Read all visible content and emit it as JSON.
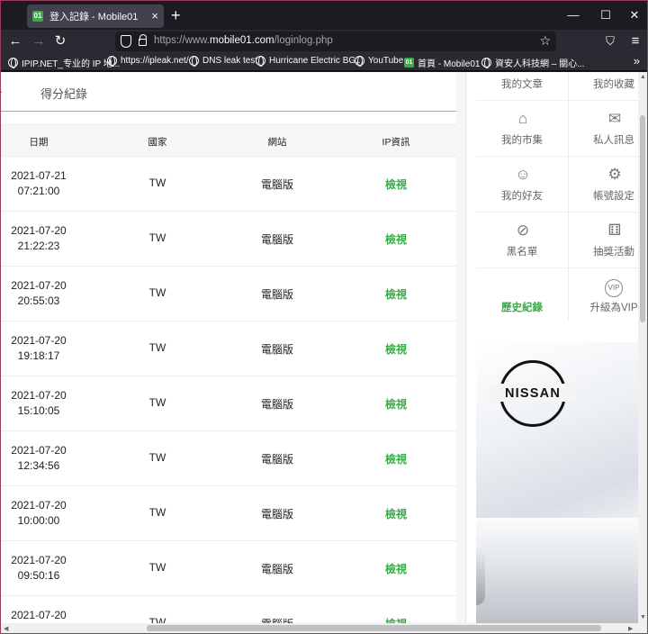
{
  "tab": {
    "title": "登入記錄 - Mobile01",
    "favicon": "01",
    "close": "×",
    "new_tab": "+"
  },
  "window": {
    "minimize": "—",
    "maximize": "☐",
    "close": "✕"
  },
  "nav": {
    "back": "←",
    "forward": "→",
    "reload": "↻",
    "url_prefix": "https://www.",
    "url_domain": "mobile01.com",
    "url_path": "/loginlog.php",
    "star": "☆",
    "pocket": "⛉",
    "menu": "≡"
  },
  "bookmarks": [
    {
      "label": "IPIP.NET_专业的 IP 地...",
      "icon": "globe-icon"
    },
    {
      "label": "https://ipleak.net/",
      "icon": "globe-icon"
    },
    {
      "label": "DNS leak test",
      "icon": "globe-icon"
    },
    {
      "label": "Hurricane Electric BG...",
      "icon": "globe-icon"
    },
    {
      "label": "YouTube",
      "icon": "globe-icon"
    },
    {
      "label": "首頁 - Mobile01",
      "icon": "mobile01-icon"
    },
    {
      "label": "資安人科技網 – 關心...",
      "icon": "globe-icon"
    }
  ],
  "bookmarks_more": "»",
  "main": {
    "tab_dot": "·",
    "tab_label": "得分紀錄",
    "columns": [
      "日期",
      "國家",
      "網站",
      "IP資訊"
    ],
    "rows": [
      {
        "date": "2021-07-21",
        "time": "07:21:00",
        "country": "TW",
        "site": "電腦版",
        "ip": "檢視"
      },
      {
        "date": "2021-07-20",
        "time": "21:22:23",
        "country": "TW",
        "site": "電腦版",
        "ip": "檢視"
      },
      {
        "date": "2021-07-20",
        "time": "20:55:03",
        "country": "TW",
        "site": "電腦版",
        "ip": "檢視"
      },
      {
        "date": "2021-07-20",
        "time": "19:18:17",
        "country": "TW",
        "site": "電腦版",
        "ip": "檢視"
      },
      {
        "date": "2021-07-20",
        "time": "15:10:05",
        "country": "TW",
        "site": "電腦版",
        "ip": "檢視"
      },
      {
        "date": "2021-07-20",
        "time": "12:34:56",
        "country": "TW",
        "site": "電腦版",
        "ip": "檢視"
      },
      {
        "date": "2021-07-20",
        "time": "10:00:00",
        "country": "TW",
        "site": "電腦版",
        "ip": "檢視"
      },
      {
        "date": "2021-07-20",
        "time": "09:50:16",
        "country": "TW",
        "site": "電腦版",
        "ip": "檢視"
      },
      {
        "date": "2021-07-20",
        "time": "",
        "country": "TW",
        "site": "電腦版",
        "ip": "檢視"
      }
    ]
  },
  "sidebar": {
    "tiles": [
      {
        "label": "我的文章",
        "icon": ""
      },
      {
        "label": "我的收藏",
        "icon": ""
      },
      {
        "label": "我的市集",
        "icon": "⌂"
      },
      {
        "label": "私人訊息",
        "icon": "✉"
      },
      {
        "label": "我的好友",
        "icon": "☺"
      },
      {
        "label": "帳號設定",
        "icon": "⚙"
      },
      {
        "label": "黑名單",
        "icon": "⊘"
      },
      {
        "label": "抽獎活動",
        "icon": "⚅"
      },
      {
        "label": "歷史紀錄",
        "icon": ""
      },
      {
        "label": "升級為VIP",
        "icon": "VIP"
      }
    ],
    "active_color": "#3aaa4a",
    "ad_brand": "NISSAN"
  }
}
